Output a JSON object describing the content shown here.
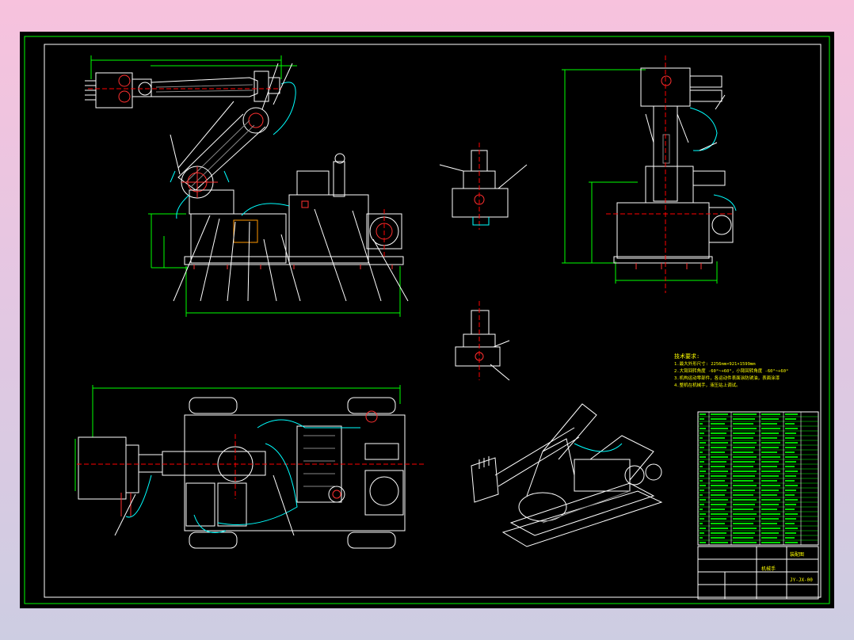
{
  "drawing": {
    "technical_notes": {
      "heading": "技术要求:",
      "lines": [
        "1.最大外形尺寸: 2256mm×921×1599mm",
        "2.大臂回转角度 -60°~+60°，小臂回转角度 -60°~+60°",
        "3.机构运动零部件，各运动件表面涂防锈油，表面涂漆",
        "4.整机在机械手，液压站上调试。"
      ]
    },
    "title_block": {
      "drawing_number": "JY-JX-00",
      "title": "机械手",
      "company": "装配图"
    },
    "colors": {
      "background": "#000000",
      "primary_line": "#ffffff",
      "dimension_line": "#00ff00",
      "center_line": "#ff0000",
      "hydraulic_line": "#00ffff",
      "text": "#ffff00"
    }
  }
}
